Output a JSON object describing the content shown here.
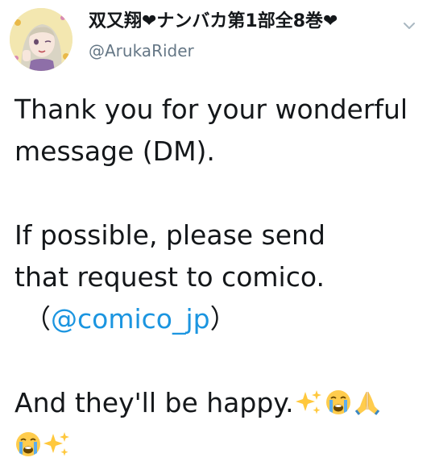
{
  "tweet": {
    "display_name": "双又翔❤ナンバカ第1部全8巻❤",
    "username": "@ArukaRider",
    "body": {
      "line1": "Thank you for your wonderful",
      "line2": "message (DM).",
      "line3": "If possible, please send",
      "line4": "that request to comico.",
      "paren_open": "（",
      "mention": "@comico_jp",
      "paren_close": "）",
      "line6": "And they'll be happy."
    },
    "emojis": [
      "sparkles",
      "loudly-crying-face",
      "folded-hands",
      "loudly-crying-face",
      "sparkles"
    ]
  },
  "colors": {
    "text": "#14171a",
    "secondary": "#657786",
    "link": "#1b95e0"
  }
}
